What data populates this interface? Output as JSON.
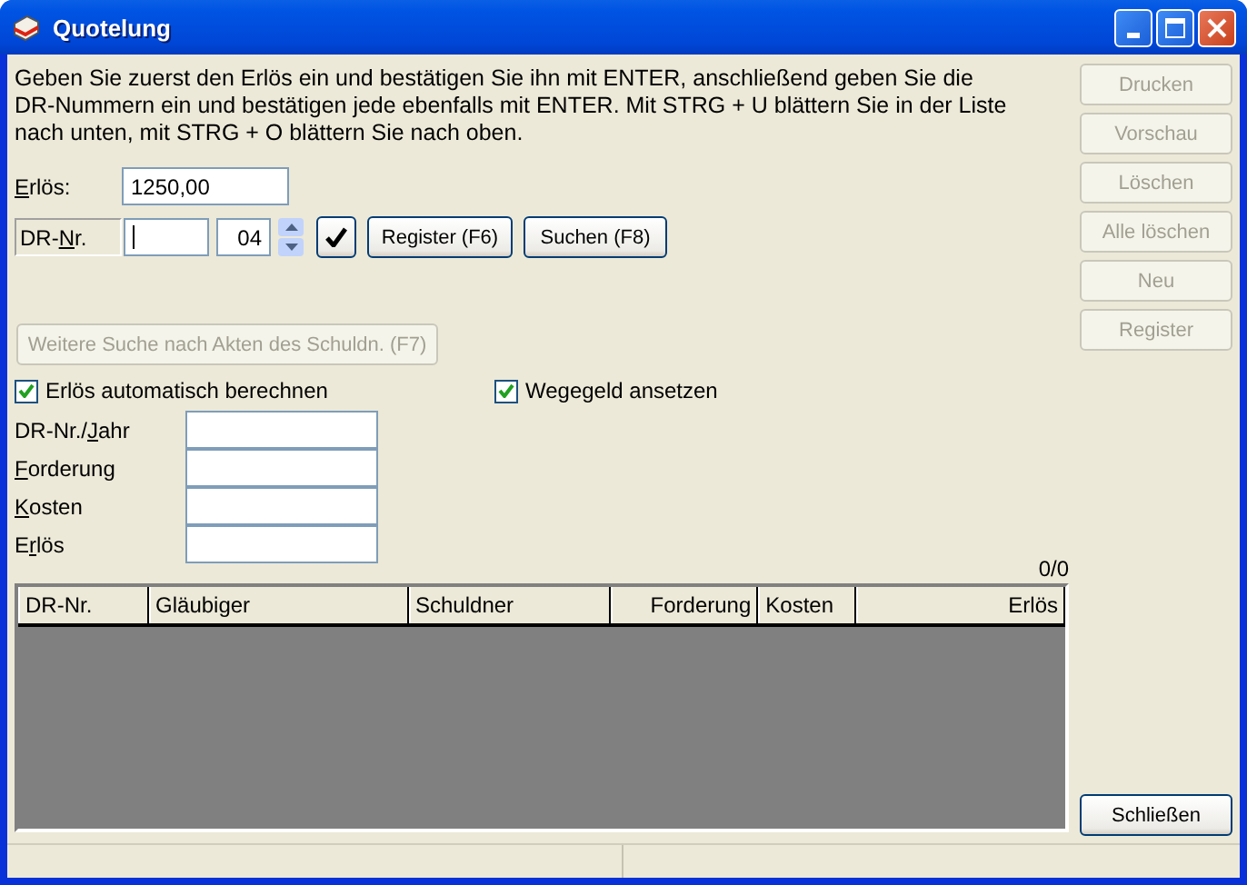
{
  "window": {
    "title": "Quotelung"
  },
  "instructions": [
    "Geben Sie zuerst den Erlös ein und bestätigen Sie ihn mit ENTER, anschließend geben Sie die",
    "DR-Nummern ein und bestätigen jede ebenfalls mit ENTER. Mit STRG + U blättern Sie in der Liste",
    "nach unten, mit STRG + O blättern Sie nach oben."
  ],
  "erloes": {
    "label": {
      "key": "E",
      "rest": "rlös:"
    },
    "value": "1250,00"
  },
  "dr_nr": {
    "label": {
      "pre": "DR-",
      "key": "N",
      "rest": "r."
    },
    "year": "04",
    "focused": true
  },
  "row_buttons": [
    {
      "kind": "check"
    },
    {
      "kind": "text",
      "label": "Register (F6)"
    },
    {
      "kind": "text",
      "label": "Suchen (F8)"
    }
  ],
  "search_more": {
    "label": "Weitere Suche nach Akten des Schuldn. (F7)",
    "disabled": true
  },
  "checkboxes": [
    {
      "label": "Erlös automatisch berechnen",
      "checked": true
    },
    {
      "label": "Wegegeld ansetzen",
      "checked": true
    }
  ],
  "fields": [
    {
      "label": {
        "pre": "DR-Nr./",
        "key": "J",
        "rest": "ahr"
      }
    },
    {
      "label": {
        "key": "F",
        "rest": "orderung"
      }
    },
    {
      "label": {
        "key": "K",
        "rest": "osten"
      }
    },
    {
      "label": {
        "pre": "E",
        "key": "r",
        "rest": "lös"
      }
    }
  ],
  "counter": "0/0",
  "table": {
    "columns": [
      {
        "label": "DR-Nr."
      },
      {
        "label": "Gläubiger"
      },
      {
        "label": "Schuldner"
      },
      {
        "label": "Forderung"
      },
      {
        "label": "Kosten"
      },
      {
        "label": "Erlös"
      }
    ]
  },
  "side_buttons": [
    {
      "label": "Drucken",
      "disabled": true
    },
    {
      "label": "Vorschau",
      "disabled": true
    },
    {
      "label": "Löschen",
      "disabled": true
    },
    {
      "label": "Alle löschen",
      "disabled": true
    },
    {
      "label": "Neu",
      "disabled": true
    },
    {
      "label": "Register",
      "disabled": true
    }
  ],
  "close_button": {
    "label": "Schließen",
    "disabled": false
  }
}
